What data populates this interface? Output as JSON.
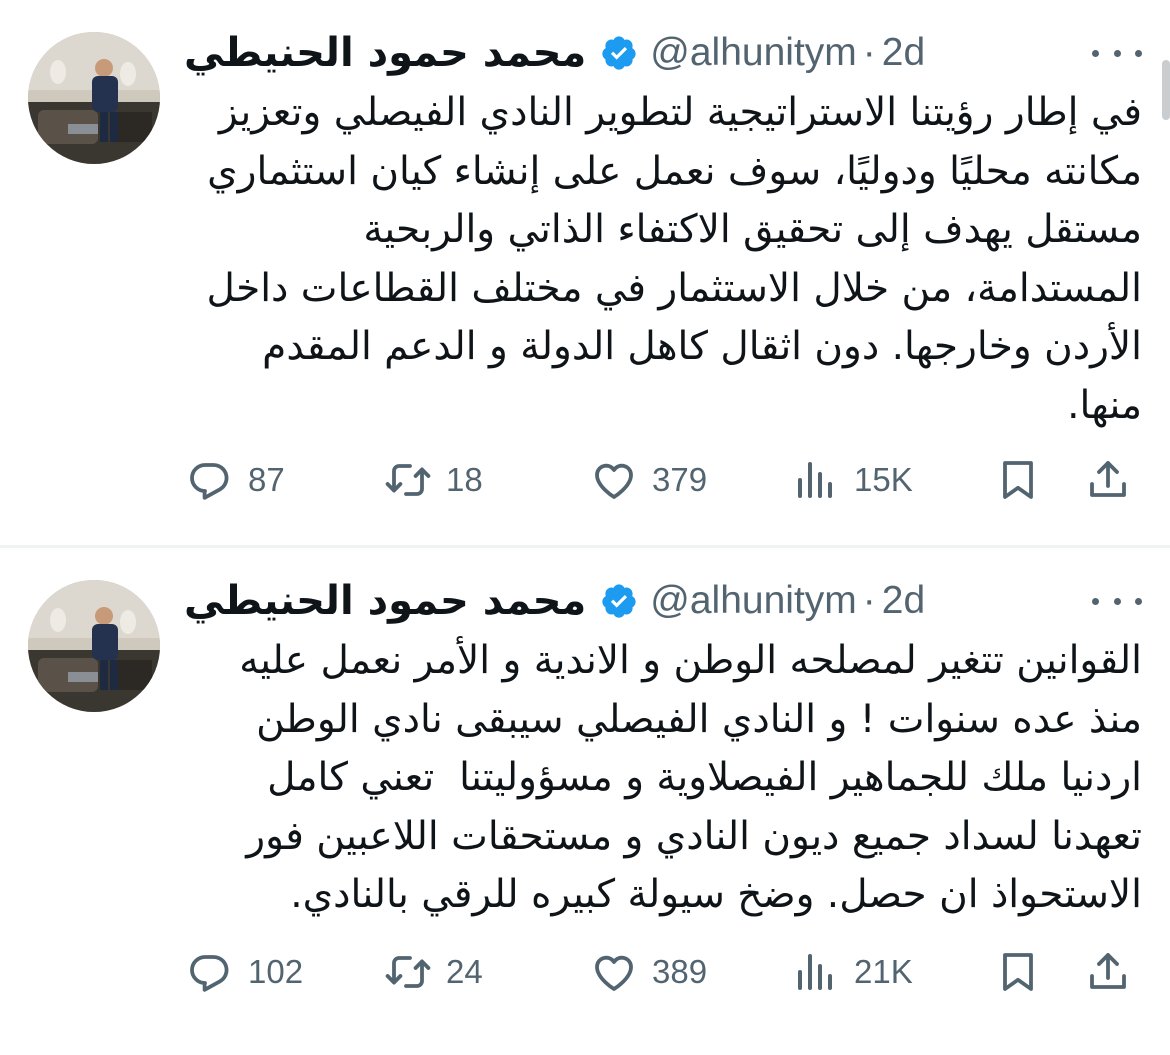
{
  "tweets": [
    {
      "author": {
        "name": "محمد حمود الحنيطي",
        "handle": "@alhunitym",
        "time": "2d",
        "verified": true
      },
      "text": "في إطار رؤيتنا الاستراتيجية لتطوير النادي الفيصلي وتعزيز مكانته محليًا ودوليًا، سوف نعمل على إنشاء كيان استثماري مستقل يهدف إلى تحقيق الاكتفاء الذاتي والربحية المستدامة، من خلال الاستثمار في مختلف القطاعات داخل الأردن وخارجها. دون اثقال كاهل الدولة و الدعم المقدم منها.",
      "stats": {
        "replies": "87",
        "retweets": "18",
        "likes": "379",
        "views": "15K"
      }
    },
    {
      "author": {
        "name": "محمد حمود الحنيطي",
        "handle": "@alhunitym",
        "time": "2d",
        "verified": true
      },
      "text": "القوانين تتغير لمصلحه الوطن و الاندية و الأمر نعمل عليه منذ عده سنوات ! و النادي الفيصلي سيبقى نادي الوطن اردنيا ملك للجماهير الفيصلاوية و مسؤوليتنا  تعني كامل تعهدنا لسداد جميع ديون النادي و مستحقات اللاعبين فور الاستحواذ ان حصل. وضخ سيولة كبيره للرقي بالنادي.",
      "stats": {
        "replies": "102",
        "retweets": "24",
        "likes": "389",
        "views": "21K"
      }
    }
  ],
  "icons": {
    "reply": "reply-icon",
    "retweet": "retweet-icon",
    "like": "heart-icon",
    "views": "views-icon",
    "bookmark": "bookmark-icon",
    "share": "share-icon",
    "verified": "verified-badge-icon",
    "more": "more-icon"
  },
  "colors": {
    "text": "#0f1419",
    "secondary": "#536471",
    "verified": "#1d9bf0",
    "divider": "#eff3f4"
  }
}
